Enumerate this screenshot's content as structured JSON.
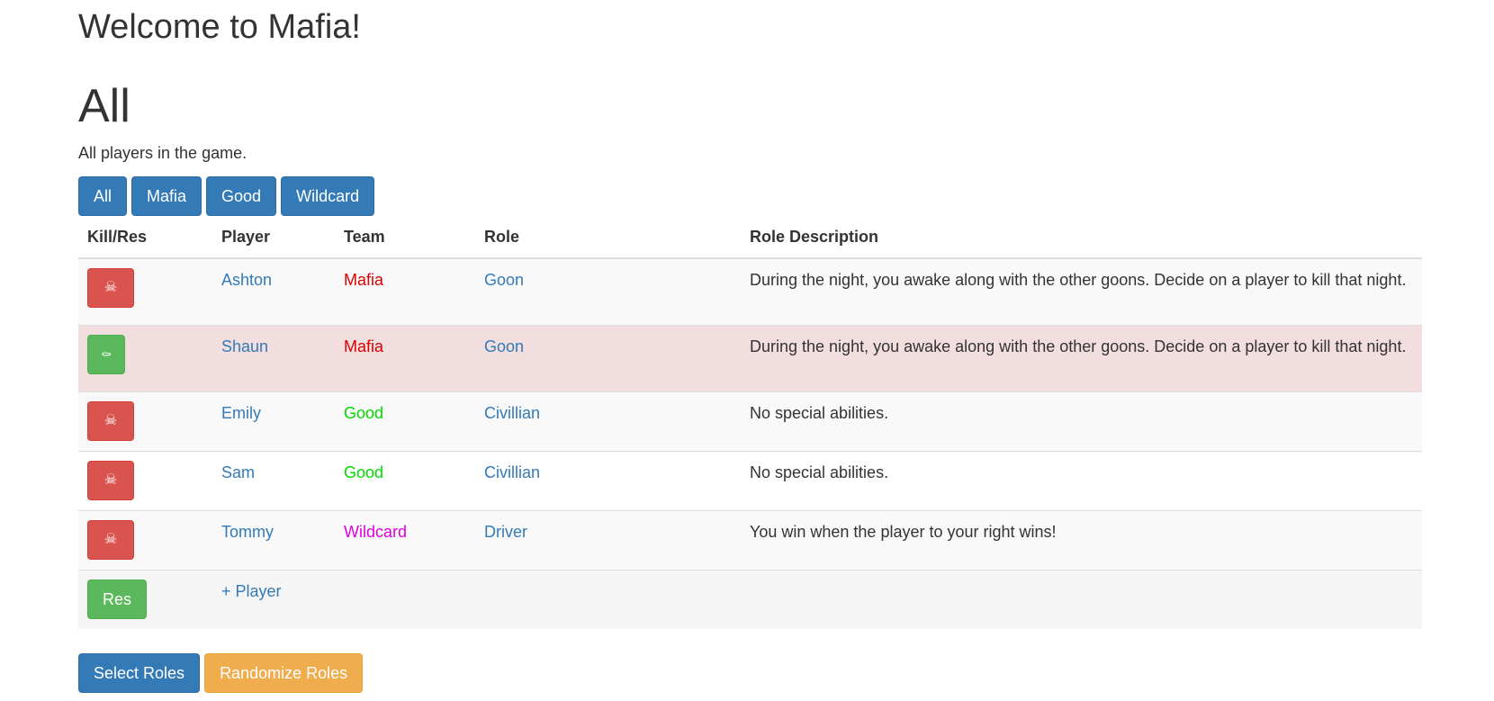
{
  "app_title": "Welcome to Mafia!",
  "section": {
    "title": "All",
    "description": "All players in the game."
  },
  "filters": [
    "All",
    "Mafia",
    "Good",
    "Wildcard"
  ],
  "table": {
    "headers": [
      "Kill/Res",
      "Player",
      "Team",
      "Role",
      "Role Description"
    ],
    "rows": [
      {
        "player": "Ashton",
        "team": "Mafia",
        "team_color": "#dd0000",
        "role": "Goon",
        "description": "During the night, you awake along with the other goons. Decide on a player to kill that night.",
        "action": "kill",
        "action_icon": "skull-crossbones-icon",
        "state": "alive"
      },
      {
        "player": "Shaun",
        "team": "Mafia",
        "team_color": "#dd0000",
        "role": "Goon",
        "description": "During the night, you awake along with the other goons. Decide on a player to kill that night.",
        "action": "res",
        "action_icon": "tombstone-icon",
        "state": "dead"
      },
      {
        "player": "Emily",
        "team": "Good",
        "team_color": "#00dd00",
        "role": "Civillian",
        "description": "No special abilities.",
        "action": "kill",
        "action_icon": "skull-crossbones-icon",
        "state": "alive"
      },
      {
        "player": "Sam",
        "team": "Good",
        "team_color": "#00dd00",
        "role": "Civillian",
        "description": "No special abilities.",
        "action": "kill",
        "action_icon": "skull-crossbones-icon",
        "state": "alive"
      },
      {
        "player": "Tommy",
        "team": "Wildcard",
        "team_color": "#dd00dd",
        "role": "Driver",
        "description": "You win when the player to your right wins!",
        "action": "kill",
        "action_icon": "skull-crossbones-icon",
        "state": "alive"
      }
    ],
    "add_row": {
      "res_label": "Res",
      "add_player_label": "+ Player"
    }
  },
  "actions": {
    "select_roles": "Select Roles",
    "randomize_roles": "Randomize Roles"
  },
  "colors": {
    "primary": "#337ab7",
    "danger": "#d9534f",
    "success": "#5cb85c",
    "warning": "#f0ad4e",
    "danger_row": "#f2dede"
  }
}
